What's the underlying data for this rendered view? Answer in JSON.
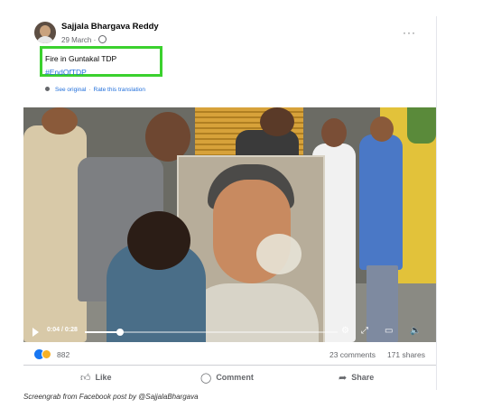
{
  "post": {
    "author": "Sajjala Bhargava Reddy",
    "date": "29 March",
    "more_glyph": "···",
    "text": "Fire in Guntakal TDP",
    "hashtag": "#EndOfTDP",
    "see_original": "See original",
    "rate_translation": "Rate this translation"
  },
  "video": {
    "time": "0:04 / 0:28",
    "progress": 0.14
  },
  "stats": {
    "reactions_count": "882",
    "comments": "23 comments",
    "shares": "171 shares",
    "reaction_icons": [
      "like-icon",
      "haha-icon"
    ]
  },
  "actions": {
    "like": "Like",
    "comment": "Comment",
    "share": "Share"
  },
  "caption": "Screengrab from Facebook post by @SajjalaBhargava",
  "colors": {
    "highlight": "#3bd12e",
    "link": "#216fdb",
    "like_blue": "#1877f2"
  }
}
